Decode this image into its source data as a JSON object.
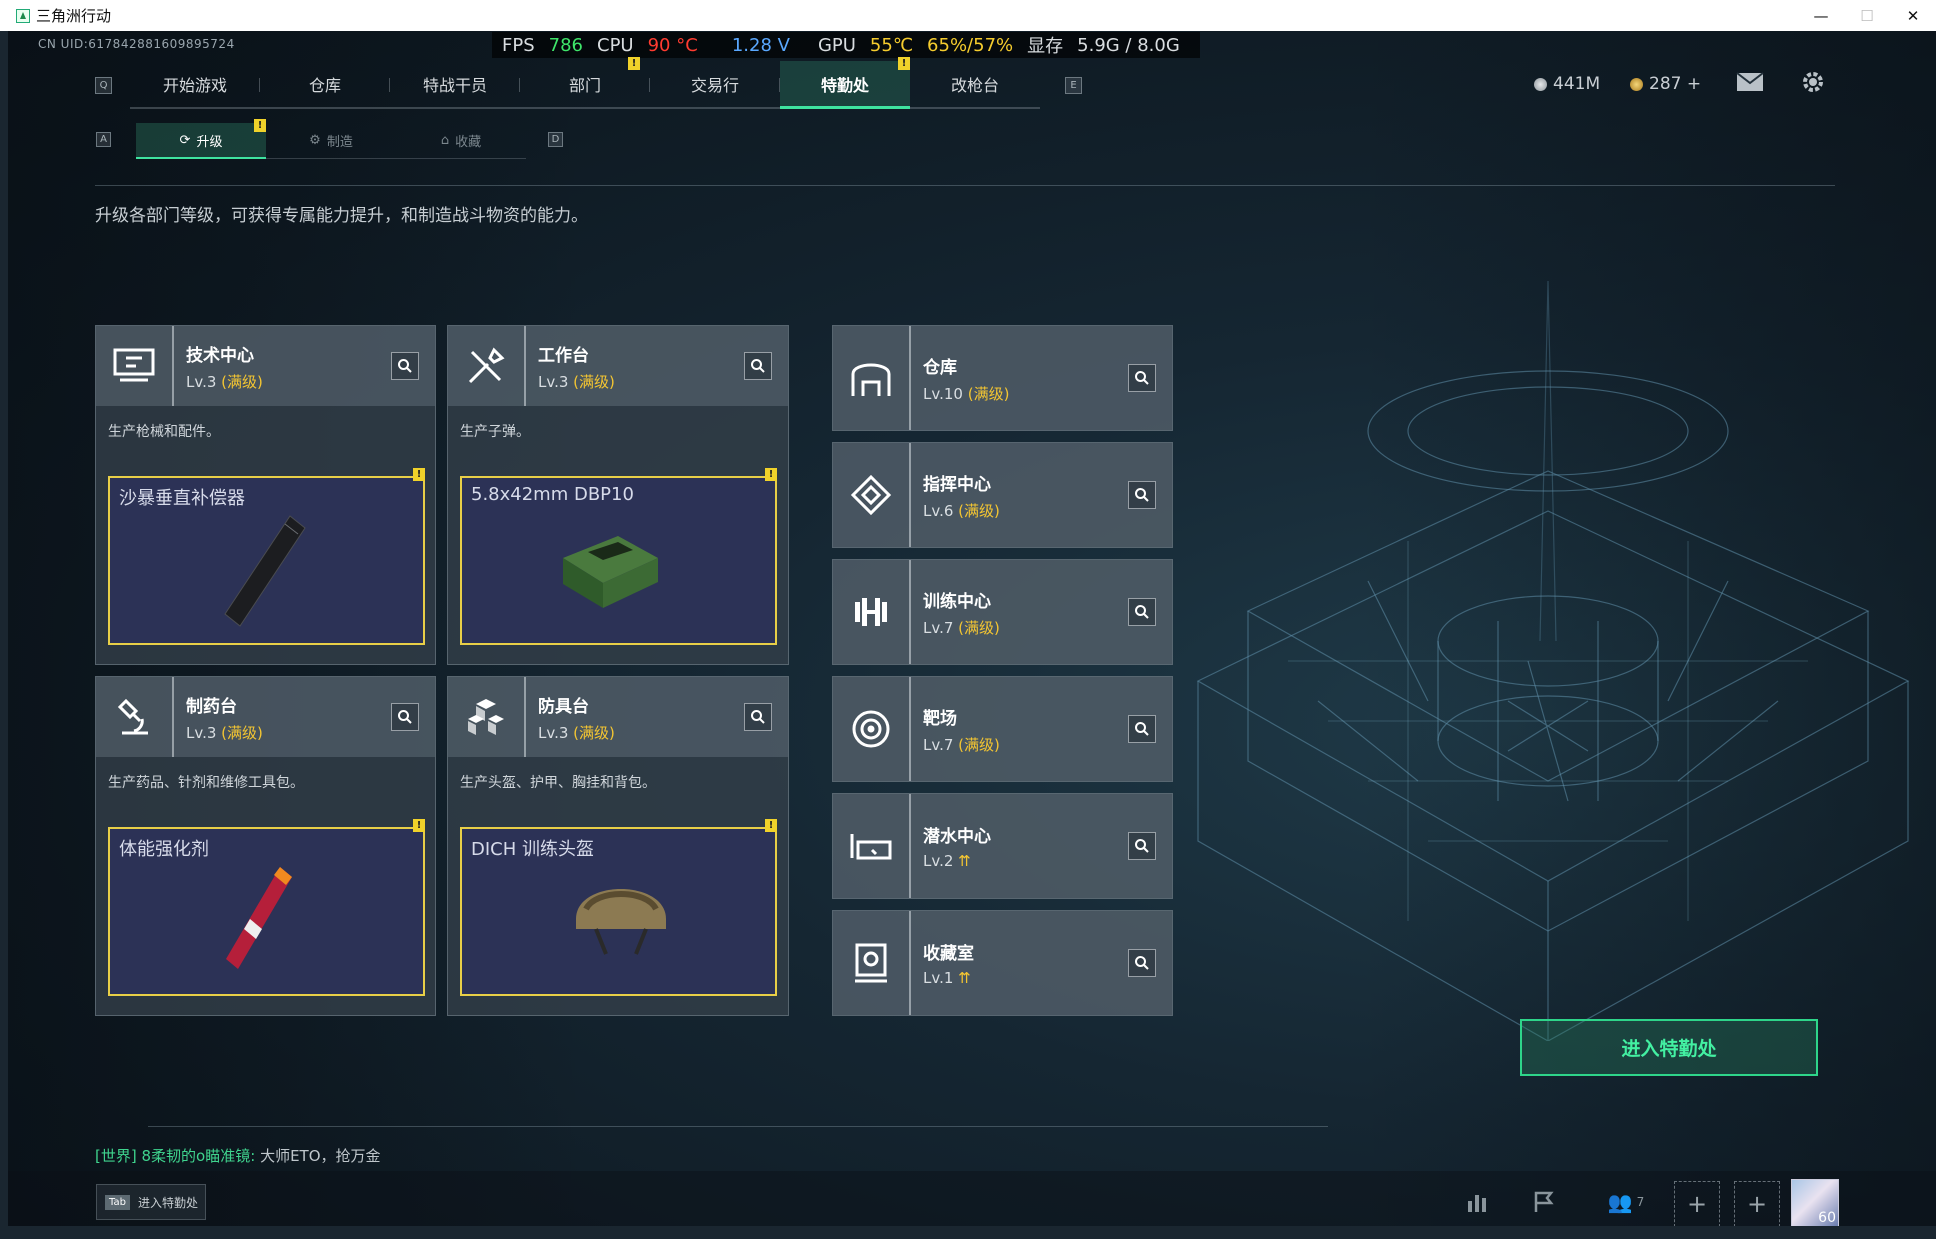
{
  "window": {
    "title": "三角洲行动",
    "controls": [
      "—",
      "☐",
      "✕"
    ]
  },
  "hud": {
    "uid": "CN UID:617842881609895724",
    "perf": [
      {
        "label": "FPS",
        "value": "786",
        "value_color": "#3fe56a"
      },
      {
        "label": "CPU",
        "value": "90 °C",
        "value_color": "#ff3b30"
      },
      {
        "label": "",
        "value": "1.28 V",
        "value_color": "#5aa8ff"
      },
      {
        "label": "GPU",
        "value": "55℃",
        "value_color": "#f5cc2e"
      },
      {
        "label": "",
        "value": "65%/57%",
        "value_color": "#f5cc2e"
      },
      {
        "label": "显存",
        "value": "5.9G / 8.0G",
        "value_color": "#d9dde0"
      }
    ]
  },
  "keys": {
    "left": "Q",
    "right": "E",
    "sub_left": "A",
    "sub_right": "D"
  },
  "nav": {
    "tabs": [
      {
        "label": "开始游戏",
        "active": false,
        "badge": ""
      },
      {
        "label": "仓库",
        "active": false,
        "badge": ""
      },
      {
        "label": "特战干员",
        "active": false,
        "badge": ""
      },
      {
        "label": "部门",
        "active": false,
        "badge": "!"
      },
      {
        "label": "交易行",
        "active": false,
        "badge": ""
      },
      {
        "label": "特勤处",
        "active": true,
        "badge": "!"
      },
      {
        "label": "改枪台",
        "active": false,
        "badge": ""
      }
    ]
  },
  "currency": {
    "silver": "441M",
    "gold": "287 +"
  },
  "subnav": {
    "tabs": [
      {
        "label": "升级",
        "active": true,
        "badge": "!"
      },
      {
        "label": "制造",
        "active": false,
        "badge": ""
      },
      {
        "label": "收藏",
        "active": false,
        "badge": ""
      }
    ]
  },
  "description": "升级各部门等级，可获得专属能力提升，和制造战斗物资的能力。",
  "large_cards": [
    {
      "name": "技术中心",
      "level": "Lv.3",
      "max": "(满级)",
      "desc": "生产枪械和配件。",
      "product": "沙暴垂直补偿器",
      "icon": "monitor-icon"
    },
    {
      "name": "工作台",
      "level": "Lv.3",
      "max": "(满级)",
      "desc": "生产子弹。",
      "product": "5.8x42mm DBP10",
      "icon": "tools-icon"
    },
    {
      "name": "制药台",
      "level": "Lv.3",
      "max": "(满级)",
      "desc": "生产药品、针剂和维修工具包。",
      "product": "体能强化剂",
      "icon": "microscope-icon"
    },
    {
      "name": "防具台",
      "level": "Lv.3",
      "max": "(满级)",
      "desc": "生产头盔、护甲、胸挂和背包。",
      "product": "DICH 训练头盔",
      "icon": "cubes-icon"
    }
  ],
  "small_cards": [
    {
      "name": "仓库",
      "level": "Lv.10",
      "max": "(满级)",
      "upgradeable": false,
      "icon": "storage-icon"
    },
    {
      "name": "指挥中心",
      "level": "Lv.6",
      "max": "(满级)",
      "upgradeable": false,
      "icon": "command-icon"
    },
    {
      "name": "训练中心",
      "level": "Lv.7",
      "max": "(满级)",
      "upgradeable": false,
      "icon": "dumbbell-icon"
    },
    {
      "name": "靶场",
      "level": "Lv.7",
      "max": "(满级)",
      "upgradeable": false,
      "icon": "target-icon"
    },
    {
      "name": "潜水中心",
      "level": "Lv.2",
      "max": "",
      "upgradeable": true,
      "icon": "diving-mask-icon"
    },
    {
      "name": "收藏室",
      "level": "Lv.1",
      "max": "",
      "upgradeable": true,
      "icon": "collection-icon"
    }
  ],
  "enter_button": "进入特勤处",
  "chat": {
    "channel": "[世界]",
    "sender": "8柔韧的o瞄准镜:",
    "message": " 大师ETO，抢万金"
  },
  "tab_hint": {
    "key": "Tab",
    "label": "进入特勤处"
  },
  "bottom": {
    "friends_count": "7",
    "avatar_level": "60"
  },
  "colors": {
    "accent": "#3fe3a0",
    "max_level": "#f3c532",
    "badge": "#f0d22a"
  }
}
